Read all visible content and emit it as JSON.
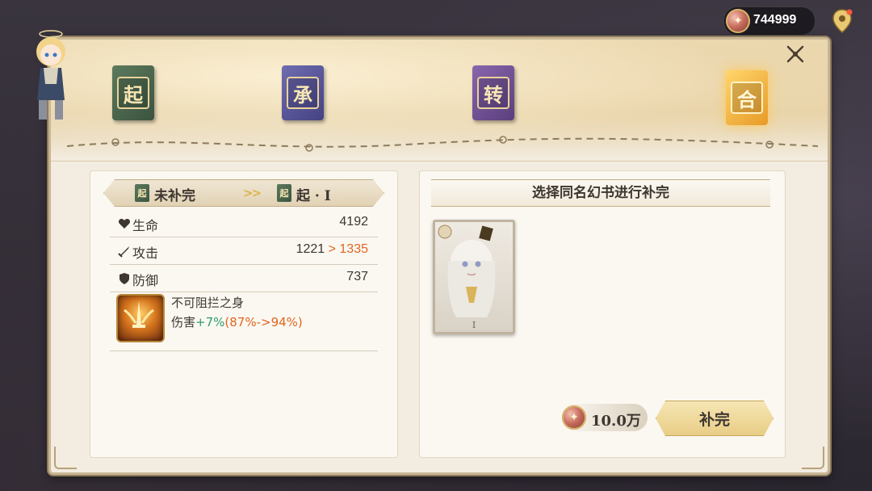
{
  "currency": {
    "amount": "744999",
    "icon": "coin-icon"
  },
  "stages": [
    {
      "glyph": "起",
      "color": "#4b6a4e"
    },
    {
      "glyph": "承",
      "color": "#5a57a0"
    },
    {
      "glyph": "转",
      "color": "#724f96"
    },
    {
      "glyph": "合",
      "color": "#f0b040"
    }
  ],
  "left_panel": {
    "from_label": "未补完",
    "from_glyph": "起",
    "to_glyph": "起",
    "to_label": "起 · I",
    "arrow": ">>",
    "stats": [
      {
        "icon": "heart-icon",
        "label": "生命",
        "value": "4192",
        "upgrade": ""
      },
      {
        "icon": "sword-icon",
        "label": "攻击",
        "value": "1221",
        "upgrade": "> 1335"
      },
      {
        "icon": "shield-icon",
        "label": "防御",
        "value": "737",
        "upgrade": ""
      }
    ],
    "skill": {
      "name": "不可阻拦之身",
      "desc_prefix": "伤害",
      "desc_bonus": "+7%",
      "desc_range": "(87%->94%)"
    }
  },
  "right_panel": {
    "title": "选择同名幻书进行补完",
    "card": {
      "level": "I"
    },
    "cost": "10.0万",
    "button_label": "补完"
  }
}
